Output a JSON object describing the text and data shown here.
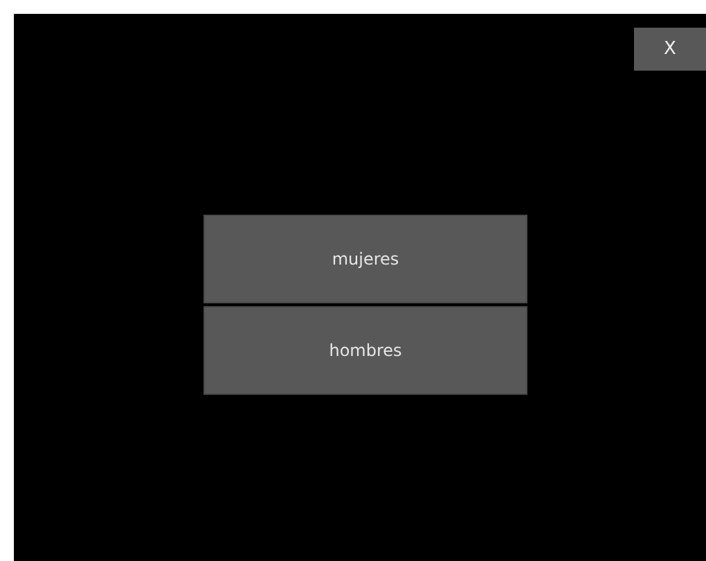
{
  "close_button": {
    "label": "X"
  },
  "options": [
    {
      "label": "mujeres"
    },
    {
      "label": "hombres"
    }
  ]
}
